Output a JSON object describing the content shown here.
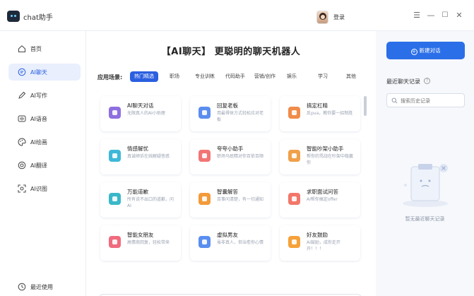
{
  "app": {
    "title": "chat助手",
    "login_label": "登录",
    "window_controls": [
      "menu-icon",
      "minimize-icon",
      "maximize-icon",
      "close-icon"
    ]
  },
  "sidebar": {
    "items": [
      {
        "label": "首页",
        "icon": "home-icon",
        "active": false
      },
      {
        "label": "AI聊天",
        "icon": "chat-icon",
        "active": true
      },
      {
        "label": "AI写作",
        "icon": "pen-icon",
        "active": false
      },
      {
        "label": "AI语音",
        "icon": "voice-icon",
        "active": false
      },
      {
        "label": "AI绘画",
        "icon": "palette-icon",
        "active": false
      },
      {
        "label": "AI翻译",
        "icon": "translate-icon",
        "active": false
      },
      {
        "label": "AI识图",
        "icon": "scan-image-icon",
        "active": false
      }
    ],
    "recent_label": "最近使用"
  },
  "main": {
    "title": "【AI聊天】 更聪明的聊天机器人",
    "scene_label": "应用场景:",
    "categories": [
      "热门精选",
      "职场",
      "专业训练",
      "代码助手",
      "营销/创作",
      "娱乐",
      "学习",
      "其他"
    ],
    "active_category": "热门精选",
    "cards": [
      {
        "title": "AI聊天对话",
        "desc": "无限真人的AI小助理",
        "color": "#8e6fe0"
      },
      {
        "title": "回复老板",
        "desc": "用最得体方式轻松应对老板",
        "color": "#5b8def"
      },
      {
        "title": "搞定杠精",
        "desc": "反pua，教你要一招制胜",
        "color": "#f08c4a"
      },
      {
        "title": "情感解忧",
        "desc": "真诚倾诉在线解疑答惑",
        "color": "#3fb8d8"
      },
      {
        "title": "夸夸小助手",
        "desc": "职场马屁精对你百依百顺",
        "color": "#f27575"
      },
      {
        "title": "智能吵架小助手",
        "desc": "帮你的骂战在吵架中稳赢你",
        "color": "#f0a04a"
      },
      {
        "title": "万能道歉",
        "desc": "所有说不出口的道歉，问AI",
        "color": "#39b8c9"
      },
      {
        "title": "智囊解答",
        "desc": "百事问清楚，有一切通知",
        "color": "#f39a3a"
      },
      {
        "title": "求职面试问答",
        "desc": "AI帮你搞定offer",
        "color": "#f2776a"
      },
      {
        "title": "智能女朋友",
        "desc": "高情商回复，轻松带来",
        "color": "#f06b7e"
      },
      {
        "title": "虚拟男友",
        "desc": "虽非真人，但治愈你心情",
        "color": "#5a8ef0"
      },
      {
        "title": "好友鼓励",
        "desc": "AI鼓励，成你走开开！！！",
        "color": "#f5a13a"
      }
    ]
  },
  "right": {
    "new_chat_label": "新建对话",
    "recent_title": "最近聊天记录",
    "search_placeholder": "搜索历史记录",
    "empty_text": "暂无最近聊天记录"
  }
}
